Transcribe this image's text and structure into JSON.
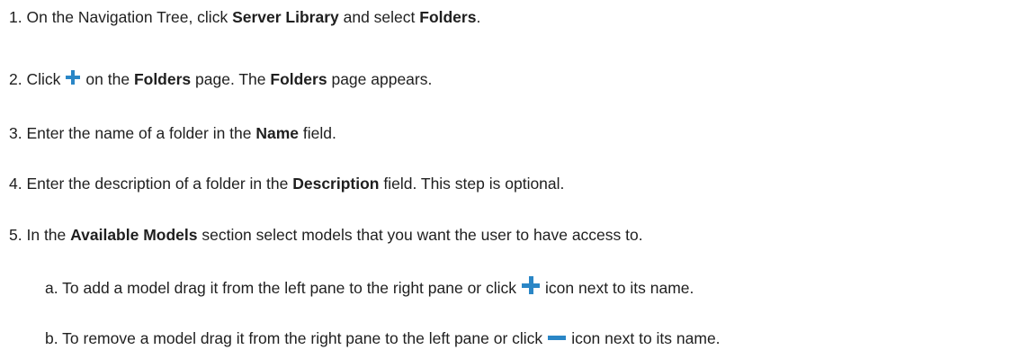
{
  "steps": [
    {
      "number": "1.",
      "t1": "On the Navigation Tree, click ",
      "b1": "Server Library",
      "t2": " and select ",
      "b2": "Folders",
      "t3": "."
    },
    {
      "number": "2.",
      "t1": "Click",
      "icon": "plus-icon",
      "t2": "on the ",
      "b1": "Folders",
      "t3": " page. The ",
      "b2": "Folders",
      "t4": " page appears."
    },
    {
      "number": "3.",
      "t1": "Enter the name of a folder in the ",
      "b1": "Name",
      "t2": " field."
    },
    {
      "number": "4.",
      "t1": "Enter the description of a folder in the ",
      "b1": "Description",
      "t2": " field. This step is optional."
    },
    {
      "number": "5.",
      "t1": "In the ",
      "b1": "Available Models",
      "t2": " section select models that you want the user to have access to."
    }
  ],
  "substeps": [
    {
      "letter": "a.",
      "t1": "To add a model drag it from the left pane to the right pane or click",
      "icon": "plus-icon",
      "t2": "icon next to its name."
    },
    {
      "letter": "b.",
      "t1": "To remove a model drag it from the right pane to the left  pane or click",
      "icon": "minus-icon",
      "t2": "icon next to its name."
    }
  ],
  "colors": {
    "icon": "#2a86c6",
    "text": "#1f1f1f"
  }
}
